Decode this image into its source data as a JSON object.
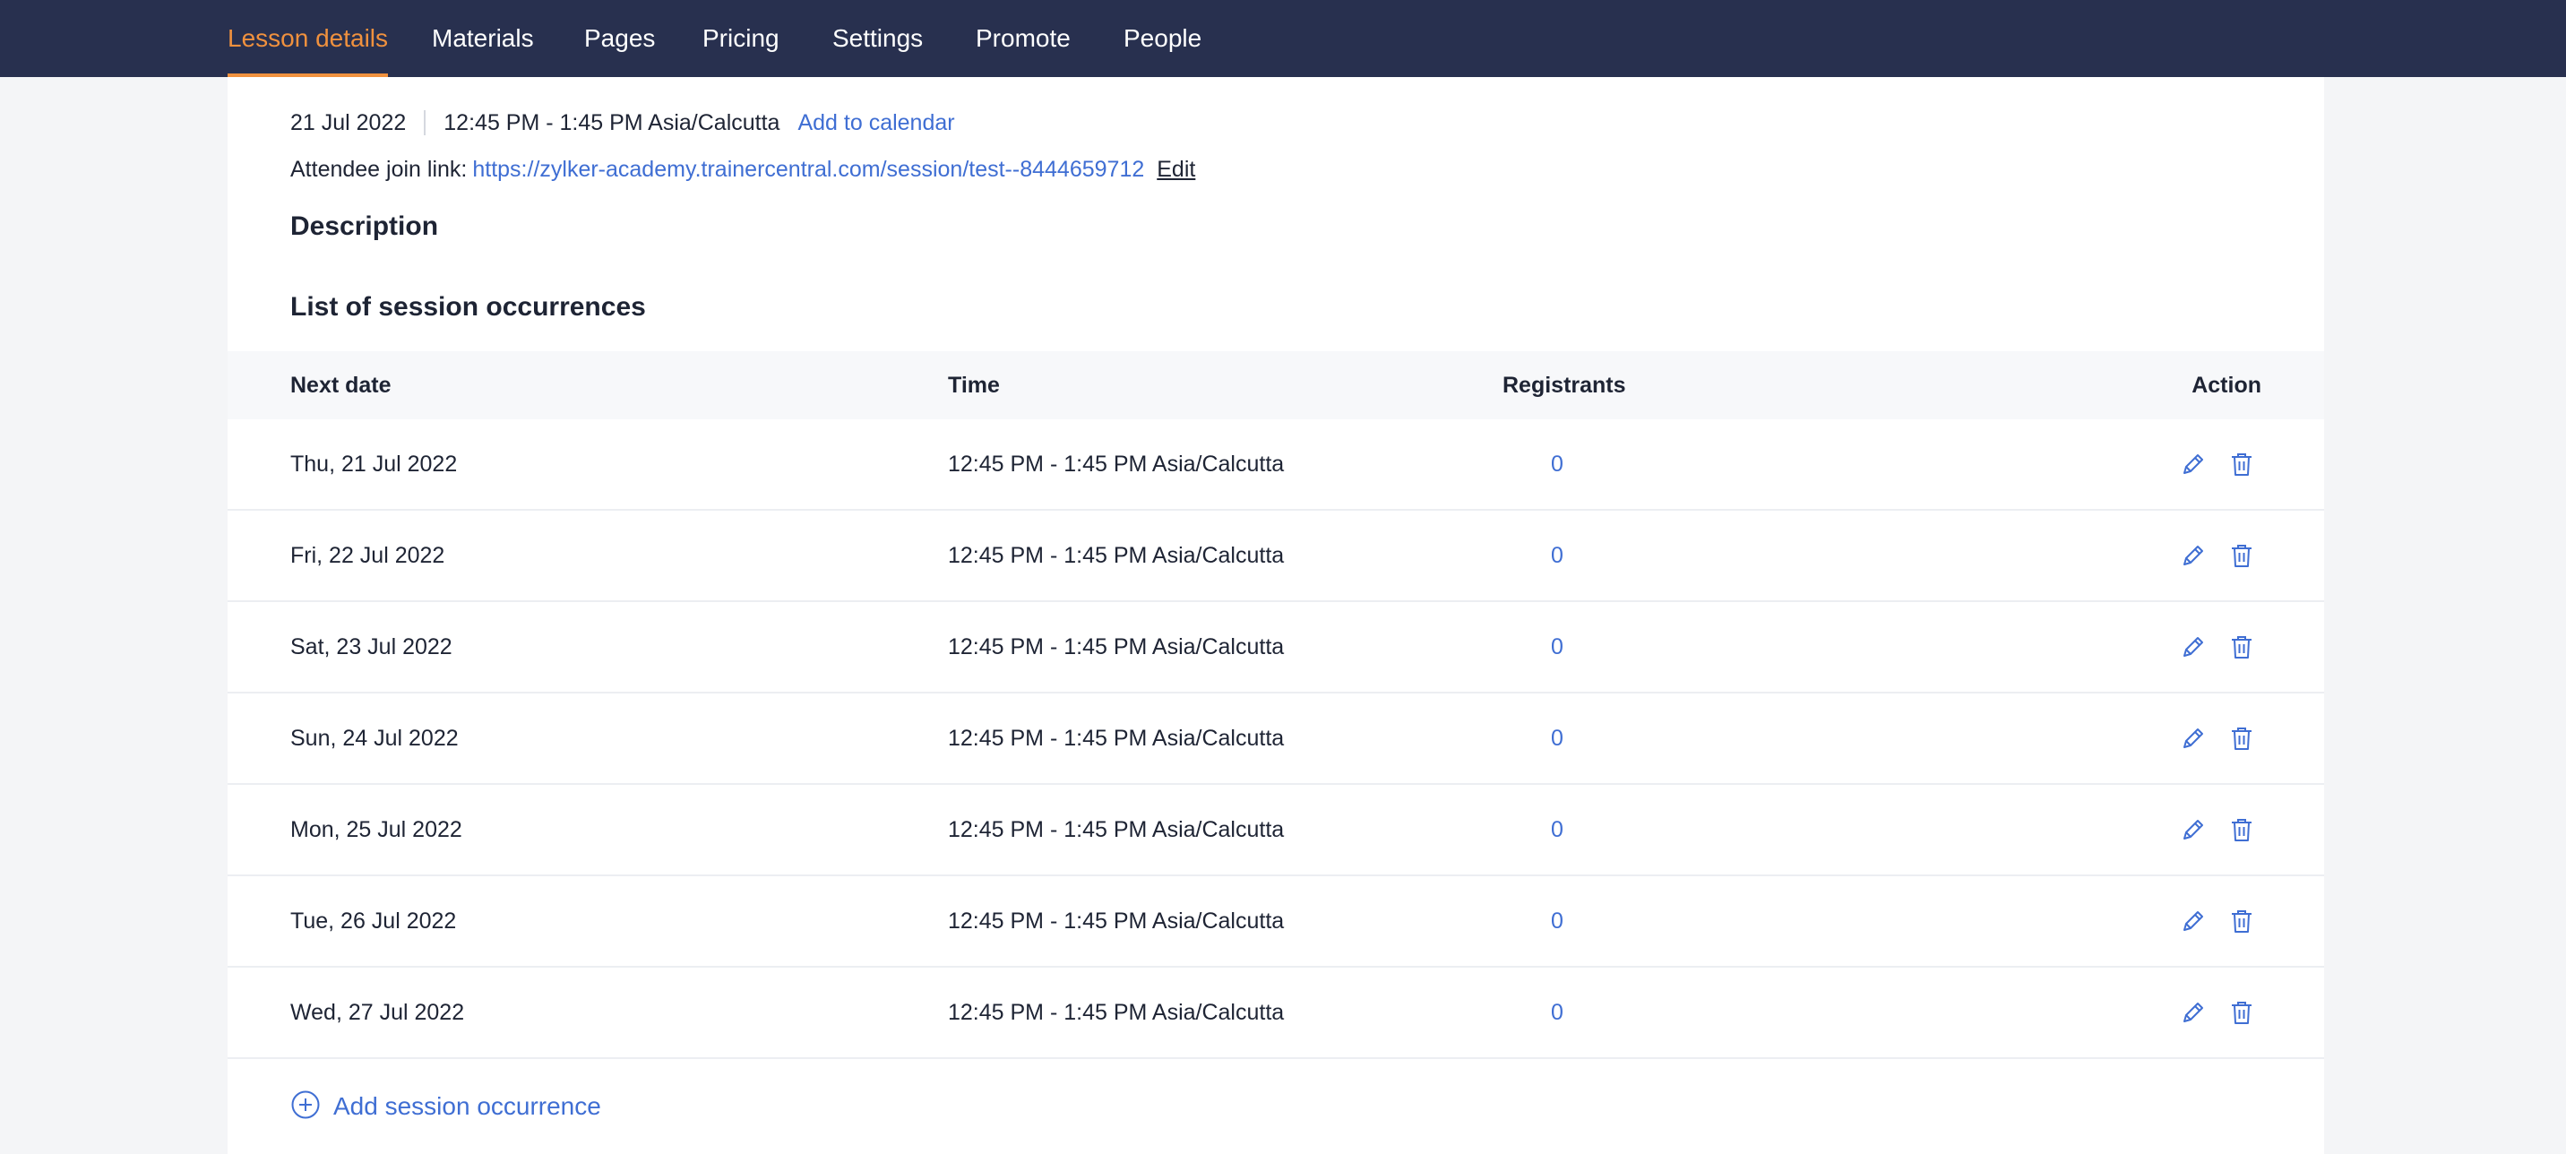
{
  "nav": {
    "tabs": [
      {
        "label": "Lesson details",
        "active": true
      },
      {
        "label": "Materials"
      },
      {
        "label": "Pages"
      },
      {
        "label": "Pricing"
      },
      {
        "label": "Settings"
      },
      {
        "label": "Promote"
      },
      {
        "label": "People"
      }
    ]
  },
  "session": {
    "date": "21 Jul 2022",
    "time": "12:45 PM - 1:45 PM Asia/Calcutta",
    "add_to_calendar": "Add to calendar",
    "join_label": "Attendee join link:",
    "join_url": "https://zylker-academy.trainercentral.com/session/test--8444659712",
    "edit_label": "Edit"
  },
  "description": {
    "title": "Description"
  },
  "occurrences": {
    "title": "List of session occurrences",
    "columns": {
      "date": "Next date",
      "time": "Time",
      "registrants": "Registrants",
      "action": "Action"
    },
    "rows": [
      {
        "date": "Thu, 21 Jul 2022",
        "time": "12:45 PM - 1:45 PM Asia/Calcutta",
        "registrants": "0"
      },
      {
        "date": "Fri, 22 Jul 2022",
        "time": "12:45 PM - 1:45 PM Asia/Calcutta",
        "registrants": "0"
      },
      {
        "date": "Sat, 23 Jul 2022",
        "time": "12:45 PM - 1:45 PM Asia/Calcutta",
        "registrants": "0"
      },
      {
        "date": "Sun, 24 Jul 2022",
        "time": "12:45 PM - 1:45 PM Asia/Calcutta",
        "registrants": "0"
      },
      {
        "date": "Mon, 25 Jul 2022",
        "time": "12:45 PM - 1:45 PM Asia/Calcutta",
        "registrants": "0"
      },
      {
        "date": "Tue, 26 Jul 2022",
        "time": "12:45 PM - 1:45 PM Asia/Calcutta",
        "registrants": "0"
      },
      {
        "date": "Wed, 27 Jul 2022",
        "time": "12:45 PM - 1:45 PM Asia/Calcutta",
        "registrants": "0"
      }
    ],
    "add_label": "Add session occurrence"
  },
  "icons": {
    "edit": "pencil-icon",
    "delete": "trash-icon",
    "add": "plus-circle-icon"
  },
  "colors": {
    "nav_bg": "#28304f",
    "accent": "#f0913e",
    "link": "#3f6ed3",
    "page_bg": "#f4f5f7"
  }
}
